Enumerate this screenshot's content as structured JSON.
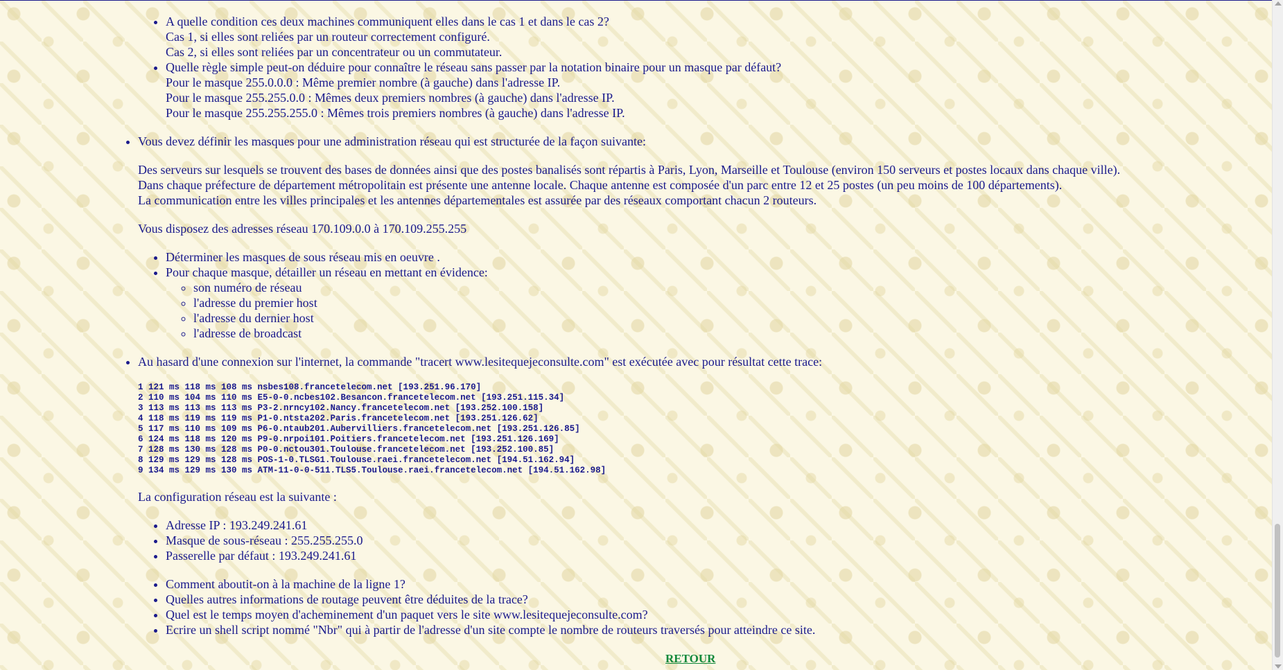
{
  "cont_questions": [
    {
      "q": "A quelle condition ces deux machines communiquent elles dans le cas 1 et dans le cas 2?",
      "lines": [
        "Cas 1, si elles sont reliées par un routeur correctement configuré.",
        "Cas 2, si elles sont reliées par un concentrateur ou un commutateur."
      ]
    },
    {
      "q": "Quelle règle simple peut-on déduire pour connaître le réseau sans passer par la notation binaire pour un masque par défaut?",
      "lines": [
        "Pour le masque 255.0.0.0 : Même premier nombre (à gauche) dans l'adresse IP.",
        "Pour le masque 255.255.0.0 : Mêmes deux premiers nombres (à gauche) dans l'adresse IP.",
        "Pour le masque 255.255.255.0 : Mêmes trois premiers nombres (à gauche) dans l'adresse IP."
      ]
    }
  ],
  "masks": {
    "intro": "Vous devez définir les masques pour une administration réseau qui est structurée de la façon suivante:",
    "para1": "Des serveurs sur lesquels se trouvent des bases de données ainsi que des postes banalisés sont répartis à Paris, Lyon, Marseille et Toulouse (environ 150 serveurs et postes locaux dans chaque ville).",
    "para2": "Dans chaque préfecture de département métropolitain est présente une antenne locale. Chaque antenne est composée d'un parc entre 12 et 25 postes (un peu moins de 100 départements).",
    "para3": "La communication entre les villes principales et les antennes départementales est assurée par des réseaux comportant chacun 2 routeurs.",
    "range": "Vous disposez des adresses réseau 170.109.0.0 à 170.109.255.255",
    "q1": "Déterminer les masques de sous réseau mis en oeuvre .",
    "q2": "Pour chaque masque, détailler un réseau en mettant en évidence:",
    "sub": [
      "son numéro de réseau",
      "l'adresse du premier host",
      "l'adresse du dernier host",
      "l'adresse de broadcast"
    ]
  },
  "tracert": {
    "intro": "Au hasard d'une connexion sur l'internet, la commande \"tracert www.lesitequejeconsulte.com\" est exécutée avec pour résultat cette trace:",
    "trace": [
      "1 121 ms 118 ms 108 ms nsbes108.francetelecom.net [193.251.96.170]",
      "2 110 ms 104 ms 110 ms E5-0-0.ncbes102.Besancon.francetelecom.net [193.251.115.34]",
      "3 113 ms 113 ms 113 ms P3-2.nrncy102.Nancy.francetelecom.net [193.252.100.158]",
      "4 118 ms 119 ms 119 ms P1-0.ntsta202.Paris.francetelecom.net [193.251.126.62]",
      "5 117 ms 110 ms 109 ms P6-0.ntaub201.Aubervilliers.francetelecom.net [193.251.126.85]",
      "6 124 ms 118 ms 120 ms P9-0.nrpoi101.Poitiers.francetelecom.net [193.251.126.169]",
      "7 128 ms 130 ms 128 ms P0-0.nctou301.Toulouse.francetelecom.net [193.252.100.85]",
      "8 129 ms 129 ms 128 ms POS-1-0.TLSG1.Toulouse.raei.francetelecom.net [194.51.162.94]",
      "9 134 ms 129 ms 130 ms ATM-11-0-0-511.TLS5.Toulouse.raei.francetelecom.net [194.51.162.98]"
    ],
    "config_intro": "La configuration réseau est la suivante :",
    "config": [
      "Adresse IP : 193.249.241.61",
      "Masque de sous-réseau : 255.255.255.0",
      "Passerelle par défaut : 193.249.241.61"
    ],
    "questions": [
      "Comment aboutit-on à la machine de la ligne 1?",
      "Quelles autres informations de routage peuvent être déduites de la trace?",
      "Quel est le temps moyen d'acheminement d'un paquet vers le site www.lesitequejeconsulte.com?",
      "Ecrire un shell script nommé \"Nbr\" qui à partir de l'adresse d'un site compte le nombre de routeurs traversés pour atteindre ce site."
    ]
  },
  "retour": "RETOUR"
}
